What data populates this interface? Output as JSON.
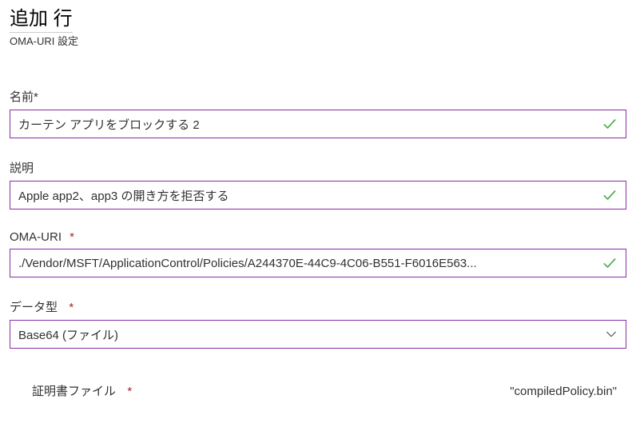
{
  "header": {
    "title": "追加 行",
    "subtitle": "OMA-URI 設定"
  },
  "fields": {
    "name": {
      "label": "名前",
      "required_marker": "*",
      "value": "カーテン アプリをブロックする 2",
      "validated": true
    },
    "description": {
      "label": "説明",
      "value": "Apple app2、app3 の開き方を拒否する",
      "validated": true
    },
    "oma_uri": {
      "label": "OMA-URI",
      "required_marker": "*",
      "value": "./Vendor/MSFT/ApplicationControl/Policies/A244370E-44C9-4C06-B551-F6016E563...",
      "validated": true
    },
    "data_type": {
      "label": "データ型",
      "required_marker": "*",
      "value": "Base64 (ファイル)"
    },
    "cert_file": {
      "label": "証明書ファイル",
      "required_marker": "*",
      "filename": "\"compiledPolicy.bin\""
    }
  },
  "colors": {
    "accent": "#8a2da5",
    "success": "#4caf50",
    "required": "#a4262c"
  }
}
